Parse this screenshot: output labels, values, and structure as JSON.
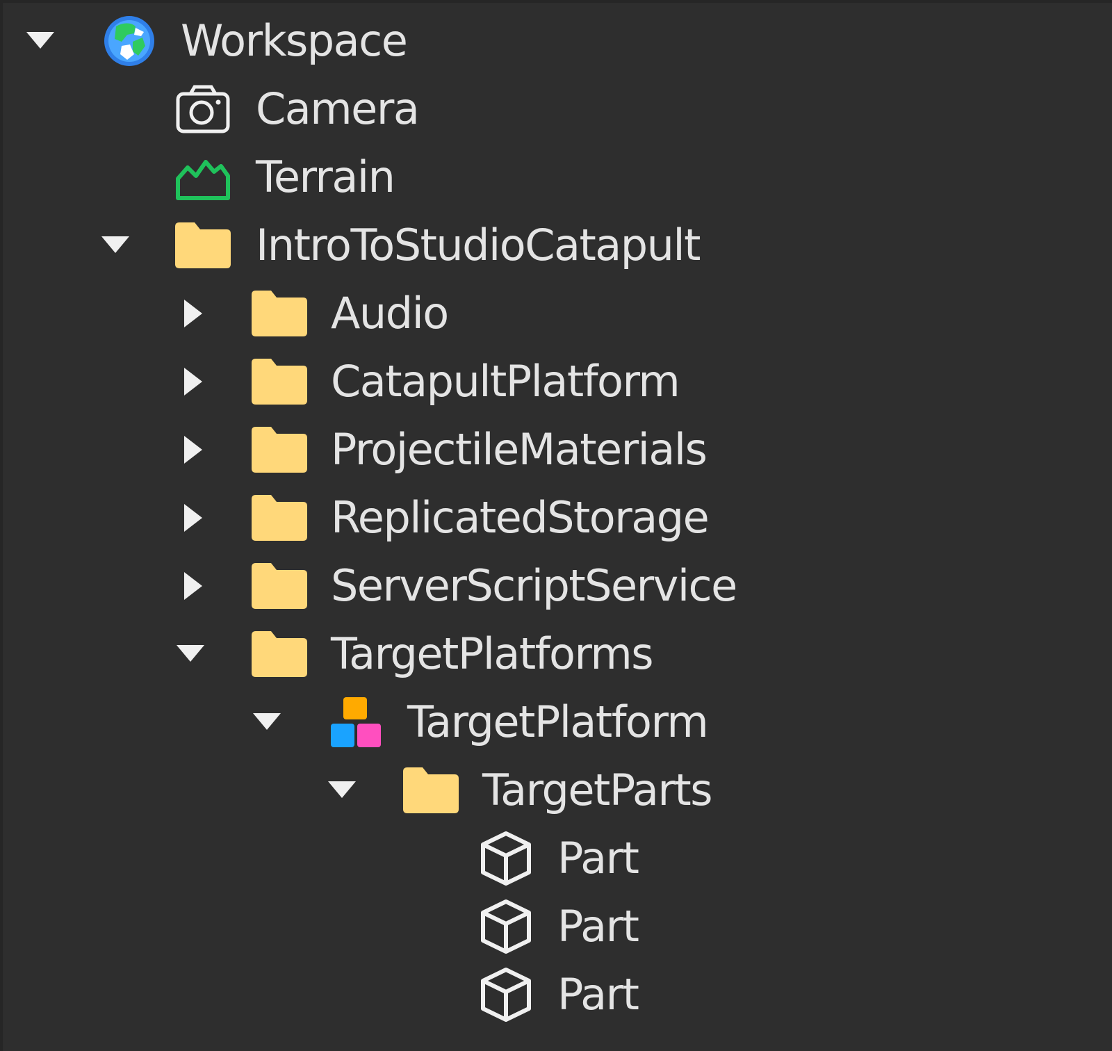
{
  "explorer": {
    "items": [
      {
        "label": "Workspace",
        "icon": "workspace-icon",
        "arrow": "expanded"
      },
      {
        "label": "Camera",
        "icon": "camera-icon",
        "arrow": "none"
      },
      {
        "label": "Terrain",
        "icon": "terrain-icon",
        "arrow": "none"
      },
      {
        "label": "IntroToStudioCatapult",
        "icon": "folder-icon",
        "arrow": "expanded"
      },
      {
        "label": "Audio",
        "icon": "folder-icon",
        "arrow": "collapsed"
      },
      {
        "label": "CatapultPlatform",
        "icon": "folder-icon",
        "arrow": "collapsed"
      },
      {
        "label": "ProjectileMaterials",
        "icon": "folder-icon",
        "arrow": "collapsed"
      },
      {
        "label": "ReplicatedStorage",
        "icon": "folder-icon",
        "arrow": "collapsed"
      },
      {
        "label": "ServerScriptService",
        "icon": "folder-icon",
        "arrow": "collapsed"
      },
      {
        "label": "TargetPlatforms",
        "icon": "folder-icon",
        "arrow": "expanded"
      },
      {
        "label": "TargetPlatform",
        "icon": "model-icon",
        "arrow": "expanded"
      },
      {
        "label": "TargetParts",
        "icon": "folder-icon",
        "arrow": "expanded"
      },
      {
        "label": "Part",
        "icon": "part-icon",
        "arrow": "none"
      },
      {
        "label": "Part",
        "icon": "part-icon",
        "arrow": "none"
      },
      {
        "label": "Part",
        "icon": "part-icon",
        "arrow": "none"
      }
    ]
  },
  "colors": {
    "background": "#2e2e2e",
    "text": "#e4e4e4",
    "folder": "#ffd87a",
    "terrain": "#1fc25b",
    "model_orange": "#ffaa00",
    "model_blue": "#1aa3ff",
    "model_pink": "#ff4fbf"
  }
}
